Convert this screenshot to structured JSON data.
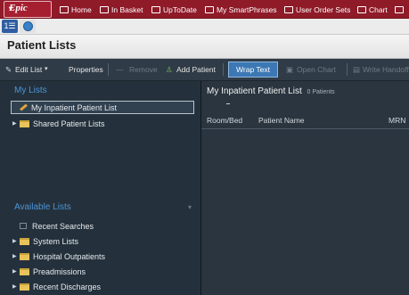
{
  "top_bar": {
    "epic_label": "Epic",
    "items": [
      "Home",
      "In Basket",
      "UpToDate",
      "My SmartPhrases",
      "User Order Sets",
      "Chart"
    ]
  },
  "tabs": [
    {
      "icon": "list-icon",
      "glyph": "1☰"
    },
    {
      "icon": "globe-icon"
    }
  ],
  "page_title": "Patient Lists",
  "toolbar": {
    "edit_list": "Edit List",
    "properties": "Properties",
    "remove": "Remove",
    "add_patient": "Add Patient",
    "wrap_text": "Wrap Text",
    "open_chart": "Open Chart",
    "write_handoff": "Write Handoff"
  },
  "left_panel": {
    "my_lists_header": "My Lists",
    "my_lists": [
      {
        "label": "My Inpatient Patient List",
        "selected": true
      },
      {
        "label": "Shared Patient Lists"
      }
    ],
    "available_header": "Available Lists",
    "available": [
      {
        "label": "Recent Searches"
      },
      {
        "label": "System Lists"
      },
      {
        "label": "Hospital Outpatients"
      },
      {
        "label": "Preadmissions"
      },
      {
        "label": "Recent Discharges"
      }
    ]
  },
  "right_panel": {
    "title": "My Inpatient Patient List",
    "count": "0 Patients",
    "columns": [
      "Room/Bed",
      "Patient Name",
      "MRN"
    ]
  },
  "colors": {
    "epic_red": "#8f1a28",
    "toolbar": "#2f3b46",
    "panel": "#24313c",
    "accent_blue": "#4d93d6"
  }
}
